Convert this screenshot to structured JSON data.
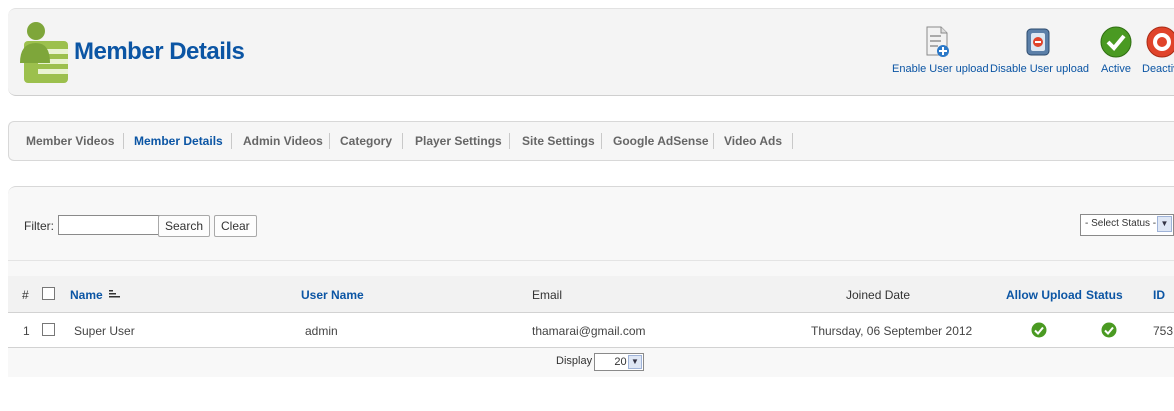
{
  "header": {
    "title": "Member Details",
    "toolbar": [
      {
        "label": "Enable User upload",
        "icon": "enable-upload-icon"
      },
      {
        "label": "Disable User upload",
        "icon": "disable-upload-icon"
      },
      {
        "label": "Active",
        "icon": "active-check-icon"
      },
      {
        "label": "Deactive",
        "icon": "deactive-icon"
      }
    ]
  },
  "tabs": [
    {
      "label": "Member Videos",
      "active": false
    },
    {
      "label": "Member Details",
      "active": true
    },
    {
      "label": "Admin Videos",
      "active": false
    },
    {
      "label": "Category",
      "active": false
    },
    {
      "label": "Player Settings",
      "active": false
    },
    {
      "label": "Site Settings",
      "active": false
    },
    {
      "label": "Google AdSense",
      "active": false
    },
    {
      "label": "Video Ads",
      "active": false
    }
  ],
  "filter": {
    "label": "Filter:",
    "value": "",
    "search_label": "Search",
    "clear_label": "Clear"
  },
  "status_select": {
    "selected": "- Select Status -"
  },
  "table": {
    "columns": [
      "#",
      "Name",
      "User Name",
      "Email",
      "Joined Date",
      "Allow Upload",
      "Status",
      "ID"
    ],
    "rows": [
      {
        "num": "1",
        "name": "Super User",
        "username": "admin",
        "email": "thamarai@gmail.com",
        "joined": "Thursday, 06 September 2012",
        "allow_upload": true,
        "status": true,
        "id": "753"
      }
    ]
  },
  "pagination": {
    "display_label": "Display #",
    "limit": "20"
  },
  "colors": {
    "accent": "#0b55a4",
    "ok_green": "#4a9a22",
    "deactive_red": "#e0432a"
  }
}
